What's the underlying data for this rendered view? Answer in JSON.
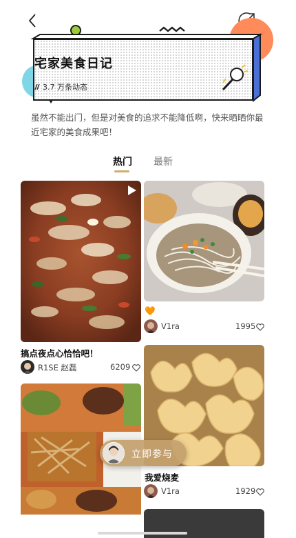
{
  "nav": {
    "back_icon": "chevron-left-icon",
    "share_icon": "share-arrow-icon"
  },
  "banner": {
    "title": "宅家美食日记",
    "count_text": "3.7 万条动态",
    "colors": {
      "card_shadow": "#4a6fd6",
      "teal": "#7fd6e6",
      "coral": "#ff8a5a",
      "green": "#9acb3c",
      "yellow": "#f2c230"
    }
  },
  "description": "虽然不能出门，但是对美食的追求不能降低啊，快来晒晒你最近宅家的美食成果吧！",
  "tabs": [
    {
      "label": "热门",
      "active": true
    },
    {
      "label": "最新",
      "active": false
    }
  ],
  "feed": {
    "left": [
      {
        "title": "搞点夜点心恰恰吧！",
        "author": "R1SE 赵磊",
        "likes": "6209",
        "is_video": true
      },
      {
        "title": "",
        "author": "",
        "likes": ""
      }
    ],
    "right": [
      {
        "title": "🧡",
        "author": "V1ra",
        "likes": "1995"
      },
      {
        "title": "我爱烧麦",
        "author": "V1ra",
        "likes": "1929"
      }
    ]
  },
  "join_button": {
    "label": "立即参与"
  },
  "accent_color": "#d4ad6a"
}
